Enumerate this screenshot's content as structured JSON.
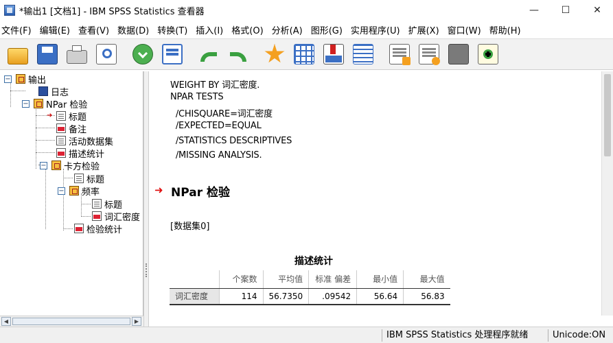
{
  "window": {
    "title": "*输出1 [文档1] - IBM SPSS Statistics 查看器",
    "controls": {
      "minimize": "—",
      "maximize": "☐",
      "close": "✕"
    }
  },
  "menu": [
    "文件(F)",
    "编辑(E)",
    "查看(V)",
    "数据(D)",
    "转换(T)",
    "插入(I)",
    "格式(O)",
    "分析(A)",
    "图形(G)",
    "实用程序(U)",
    "扩展(X)",
    "窗口(W)",
    "帮助(H)"
  ],
  "toolbar": {
    "icons": [
      "open-icon",
      "save-icon",
      "print-icon",
      "print-preview-icon",
      "export-icon",
      "recall-dialog-icon",
      "undo-icon",
      "redo-icon",
      "goto-output-icon",
      "goto-data-icon",
      "goto-variable-icon",
      "variables-icon",
      "show-all-icon",
      "designate-window-icon",
      "insert-text-icon",
      "hidden-icon",
      "add-icon"
    ],
    "accent_orange": "#f4a020",
    "accent_green": "#3aa040"
  },
  "tree": {
    "root": "输出",
    "log": "日志",
    "npar": "NPar 检验",
    "title": "标题",
    "notes": "备注",
    "active_dataset": "活动数据集",
    "descriptives": "描述统计",
    "chisquare": "卡方检验",
    "title2": "标题",
    "frequencies": "频率",
    "title3": "标题",
    "vocab_density": "词汇密度",
    "test_stats": "检验统计"
  },
  "syntax": [
    "WEIGHT BY 词汇密度.",
    "NPAR TESTS",
    "  /CHISQUARE=词汇密度",
    "  /EXPECTED=EQUAL",
    "  /STATISTICS DESCRIPTIVES",
    "  /MISSING ANALYSIS."
  ],
  "output": {
    "heading": "NPar 检验",
    "dataset": "[数据集0]",
    "table_title": "描述统计",
    "columns": [
      "个案数",
      "平均值",
      "标准 偏差",
      "最小值",
      "最大值"
    ],
    "row": {
      "label": "词汇密度",
      "values": [
        "114",
        "56.7350",
        ".09542",
        "56.64",
        "56.83"
      ]
    }
  },
  "status": {
    "main": "IBM SPSS Statistics 处理程序就绪",
    "unicode": "Unicode:ON"
  }
}
